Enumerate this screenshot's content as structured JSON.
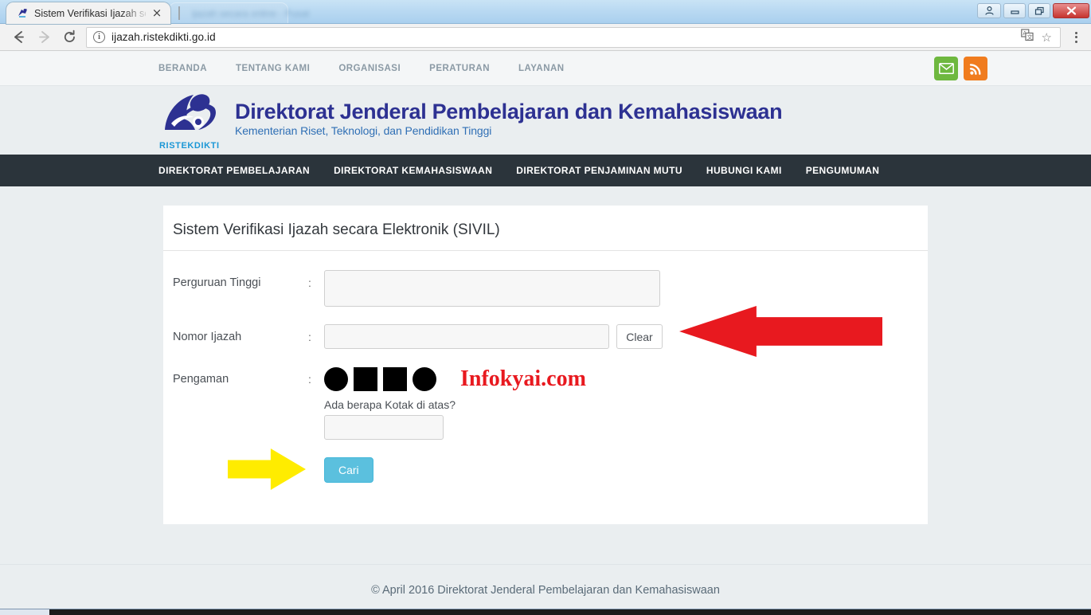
{
  "browser": {
    "tabs": [
      {
        "title": "Sistem Verifikasi Ijazah se",
        "favicon_name": "ristekdikti-favicon",
        "active": true
      },
      {
        "title": "ijazah secara online - Pusat",
        "favicon_name": "blank-favicon",
        "active": false
      }
    ],
    "tab_close_label": "×",
    "back_label": "←",
    "forward_label": "→",
    "reload_label": "⟳",
    "info_label": "i",
    "url": "ijazah.ristekdikti.go.id",
    "star_label": "☆",
    "window_controls": {
      "user_label": "□",
      "minimize_label": "–",
      "restore_label": "❐",
      "close_label": "✕"
    }
  },
  "topnav": {
    "items": [
      {
        "label": "BERANDA"
      },
      {
        "label": "TENTANG KAMI"
      },
      {
        "label": "ORGANISASI"
      },
      {
        "label": "PERATURAN"
      },
      {
        "label": "LAYANAN"
      }
    ],
    "social": [
      {
        "name": "email-icon",
        "color": "#6eb83f"
      },
      {
        "name": "rss-icon",
        "color": "#f07c1e"
      }
    ]
  },
  "brand": {
    "logo_text": "RISTEKDIKTI",
    "title": "Direktorat Jenderal Pembelajaran dan Kemahasiswaan",
    "subtitle": "Kementerian Riset, Teknologi, dan Pendidikan Tinggi",
    "title_color": "#2d3192",
    "subtitle_color": "#2f6fb5"
  },
  "mainnav": {
    "bg_color": "#2b343b",
    "items": [
      {
        "label": "DIREKTORAT PEMBELAJARAN"
      },
      {
        "label": "DIREKTORAT KEMAHASISWAAN"
      },
      {
        "label": "DIREKTORAT PENJAMINAN MUTU"
      },
      {
        "label": "HUBUNGI KAMI"
      },
      {
        "label": "PENGUMUMAN"
      }
    ]
  },
  "panel": {
    "heading": "Sistem Verifikasi Ijazah secara Elektronik (SIVIL)",
    "fields": {
      "perguruan_tinggi": {
        "label": "Perguruan Tinggi",
        "colon": ":",
        "value": "",
        "placeholder": ""
      },
      "nomor_ijazah": {
        "label": "Nomor Ijazah",
        "colon": ":",
        "value": "",
        "placeholder": ""
      },
      "pengaman": {
        "label": "Pengaman",
        "colon": ":"
      }
    },
    "clear_button": "Clear",
    "captcha": {
      "shapes": [
        "circle",
        "square",
        "square",
        "circle"
      ],
      "question": "Ada berapa Kotak di atas?",
      "answer_value": "",
      "answer_placeholder": ""
    },
    "submit_button": "Cari"
  },
  "watermark": {
    "text": "Infokyai.com",
    "color": "#e8191f"
  },
  "annotations": [
    {
      "name": "red-arrow-annotation",
      "direction": "left",
      "color": "#e8191f"
    },
    {
      "name": "yellow-arrow-annotation",
      "direction": "right",
      "color": "#ffec00"
    }
  ],
  "footer": {
    "text": "© April 2016 Direktorat Jenderal Pembelajaran dan Kemahasiswaan"
  }
}
